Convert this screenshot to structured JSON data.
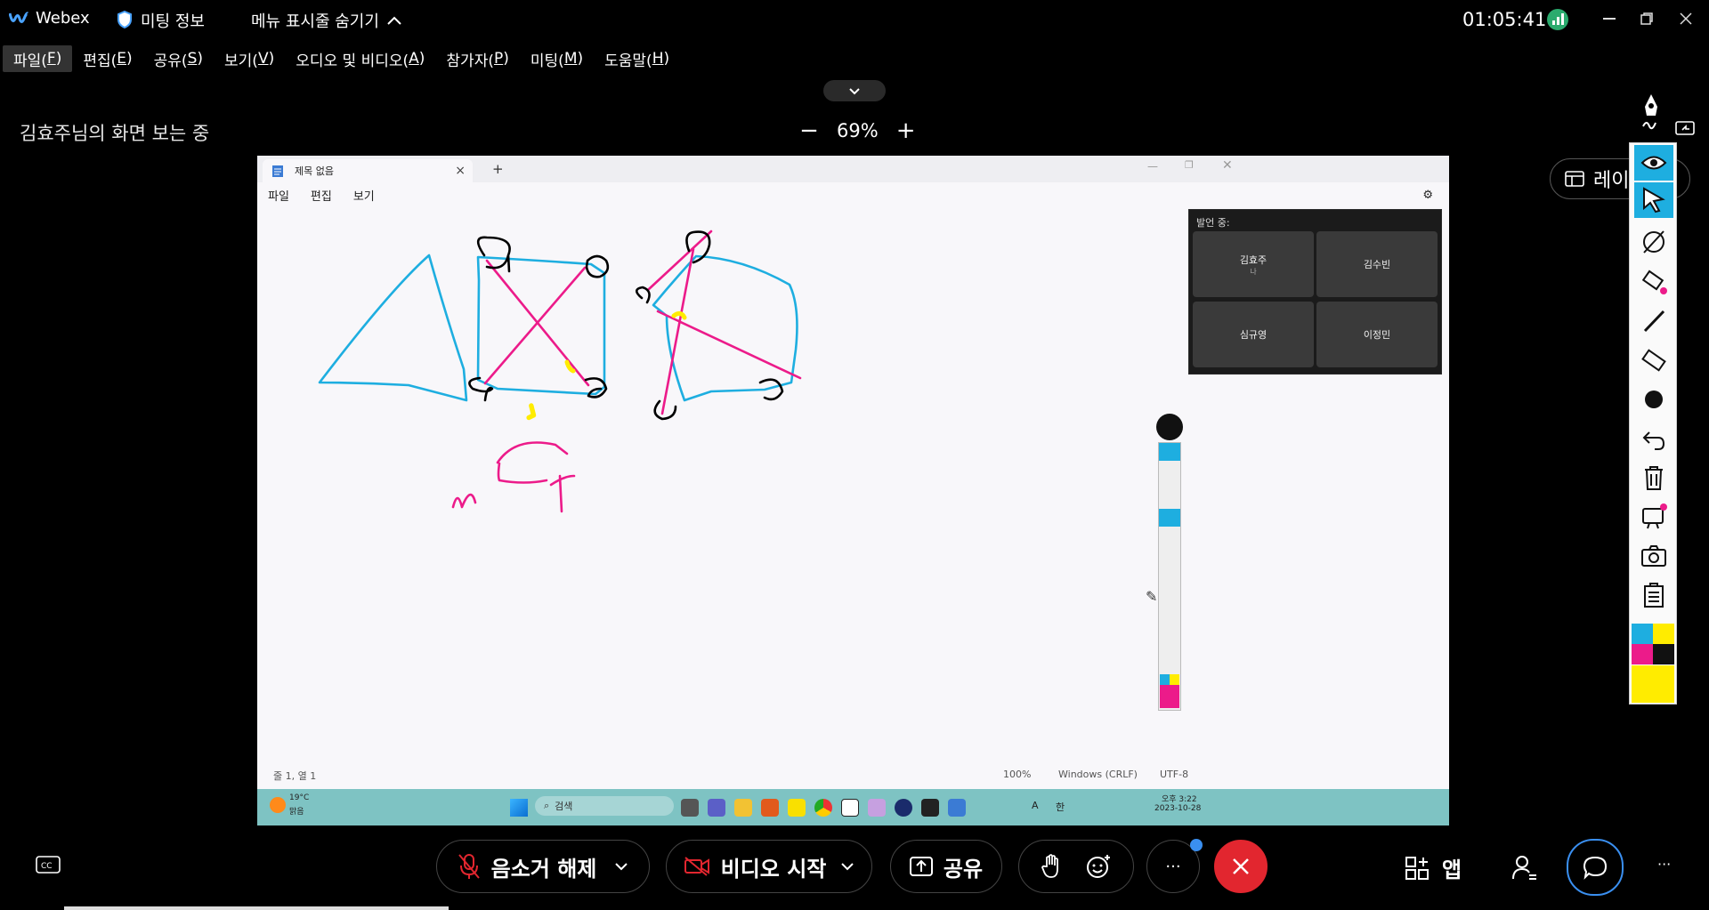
{
  "titlebar": {
    "app_name": "Webex",
    "meeting_info": "미팅 정보",
    "menu_toggle": "메뉴 표시줄 숨기기",
    "clock": "01:05:41"
  },
  "menu": [
    {
      "label": "파일(",
      "key": "F",
      "end": ")"
    },
    {
      "label": "편집(",
      "key": "E",
      "end": ")"
    },
    {
      "label": "공유(",
      "key": "S",
      "end": ")"
    },
    {
      "label": "보기(",
      "key": "V",
      "end": ")"
    },
    {
      "label": "오디오 및 비디오(",
      "key": "A",
      "end": ")"
    },
    {
      "label": "참가자(",
      "key": "P",
      "end": ")"
    },
    {
      "label": "미팅(",
      "key": "M",
      "end": ")"
    },
    {
      "label": "도움말(",
      "key": "H",
      "end": ")"
    }
  ],
  "viewing": {
    "label": "김효주님의 화면 보는 중",
    "zoom": "69%",
    "layout_btn": "레이"
  },
  "notepad": {
    "tab_title": "제목 없음",
    "menu": [
      "파일",
      "편집",
      "보기"
    ],
    "status_pos": "줄 1, 열 1",
    "status_zoom": "100%",
    "status_eol": "Windows (CRLF)",
    "status_enc": "UTF-8"
  },
  "speaker_panel": {
    "title": "발언 중:",
    "tiles": [
      {
        "name": "김효주",
        "sub": "나"
      },
      {
        "name": "김수빈",
        "sub": ""
      },
      {
        "name": "심규영",
        "sub": ""
      },
      {
        "name": "이정민",
        "sub": ""
      }
    ]
  },
  "taskbar": {
    "weather_temp": "19°C",
    "weather_desc": "맑음",
    "search": "검색",
    "ime": "한",
    "time": "오후 3:22",
    "date": "2023-10-28",
    "lang": "A"
  },
  "controls": {
    "unmute": "음소거 해제",
    "video": "비디오 시작",
    "share": "공유",
    "apps": "앱",
    "more": "···"
  },
  "colors": {
    "cyan": "#1eaee0",
    "magenta": "#ec1b8a",
    "yellow": "#ffec00",
    "end_call": "#e2262f",
    "webex_green": "#2bab6e",
    "chat_blue": "#3a8ff0"
  }
}
